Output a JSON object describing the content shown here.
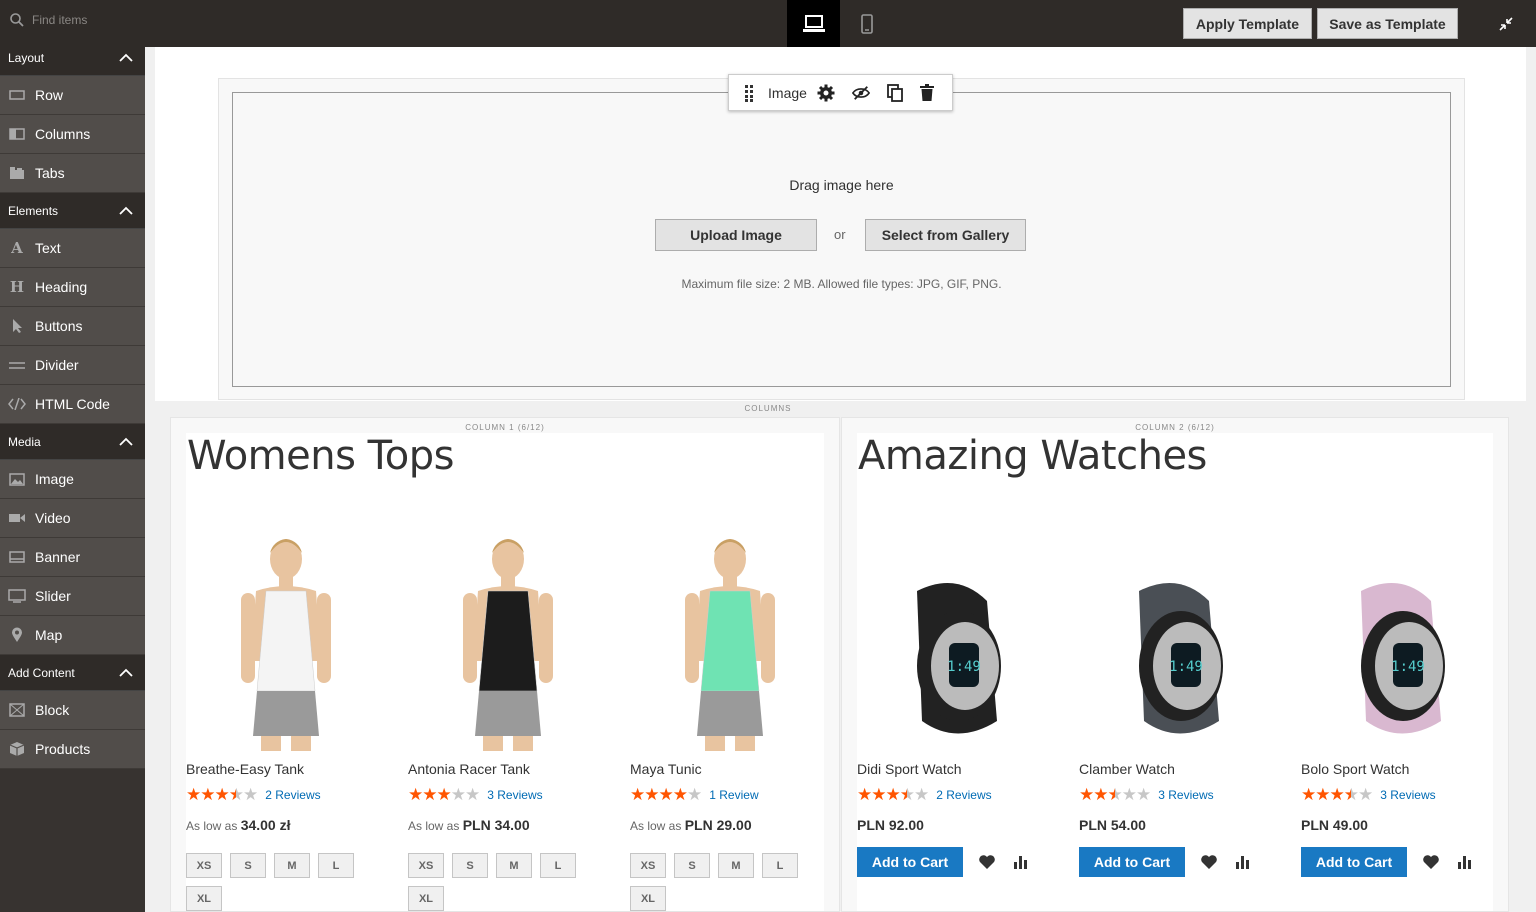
{
  "search": {
    "placeholder": "Find items"
  },
  "header": {
    "apply_label": "Apply Template",
    "save_label": "Save as Template"
  },
  "sidebar": {
    "groups": [
      {
        "label": "Layout",
        "items": [
          {
            "label": "Row",
            "icon": "row-icon"
          },
          {
            "label": "Columns",
            "icon": "columns-icon"
          },
          {
            "label": "Tabs",
            "icon": "tabs-icon"
          }
        ]
      },
      {
        "label": "Elements",
        "items": [
          {
            "label": "Text",
            "icon": "text-icon"
          },
          {
            "label": "Heading",
            "icon": "heading-icon"
          },
          {
            "label": "Buttons",
            "icon": "buttons-icon"
          },
          {
            "label": "Divider",
            "icon": "divider-icon"
          },
          {
            "label": "HTML Code",
            "icon": "code-icon"
          }
        ]
      },
      {
        "label": "Media",
        "items": [
          {
            "label": "Image",
            "icon": "image-icon"
          },
          {
            "label": "Video",
            "icon": "video-icon"
          },
          {
            "label": "Banner",
            "icon": "banner-icon"
          },
          {
            "label": "Slider",
            "icon": "slider-icon"
          },
          {
            "label": "Map",
            "icon": "map-pin-icon"
          }
        ]
      },
      {
        "label": "Add Content",
        "items": [
          {
            "label": "Block",
            "icon": "block-icon"
          },
          {
            "label": "Products",
            "icon": "products-icon"
          }
        ]
      }
    ]
  },
  "image_block": {
    "toolbar_label": "Image",
    "drag_text": "Drag image here",
    "upload_label": "Upload Image",
    "or_text": "or",
    "gallery_label": "Select from Gallery",
    "max_text": "Maximum file size: 2 MB. Allowed file types: JPG, GIF, PNG."
  },
  "columns_label": "COLUMNS",
  "col1": {
    "label": "COLUMN 1 (6/12)",
    "title": "Womens Tops",
    "products": [
      {
        "name": "Breathe-Easy Tank",
        "rating": 3.5,
        "reviews": "2  Reviews",
        "price_prefix": "As low as ",
        "price": "34.00 zł",
        "sizes": [
          "XS",
          "S",
          "M",
          "L",
          "XL"
        ],
        "color": "#f4f4f4"
      },
      {
        "name": "Antonia Racer Tank",
        "rating": 3,
        "reviews": "3  Reviews",
        "price_prefix": "As low as ",
        "price": "PLN 34.00",
        "sizes": [
          "XS",
          "S",
          "M",
          "L",
          "XL"
        ],
        "color": "#1c1c1c"
      },
      {
        "name": "Maya Tunic",
        "rating": 4,
        "reviews": "1  Review",
        "price_prefix": "As low as ",
        "price": "PLN 29.00",
        "sizes": [
          "XS",
          "S",
          "M",
          "L",
          "XL"
        ],
        "color": "#6fe3b3"
      }
    ]
  },
  "col2": {
    "label": "COLUMN 2 (6/12)",
    "title": "Amazing Watches",
    "products": [
      {
        "name": "Didi Sport Watch",
        "rating": 3.5,
        "reviews": "2  Reviews",
        "price": "PLN 92.00",
        "cart": "Add to Cart",
        "color": "#222222"
      },
      {
        "name": "Clamber Watch",
        "rating": 2.5,
        "reviews": "3  Reviews",
        "price": "PLN 54.00",
        "cart": "Add to Cart",
        "color": "#4a4f55"
      },
      {
        "name": "Bolo Sport Watch",
        "rating": 3.5,
        "reviews": "3  Reviews",
        "price": "PLN 49.00",
        "cart": "Add to Cart",
        "color": "#d9b8d0"
      }
    ]
  }
}
